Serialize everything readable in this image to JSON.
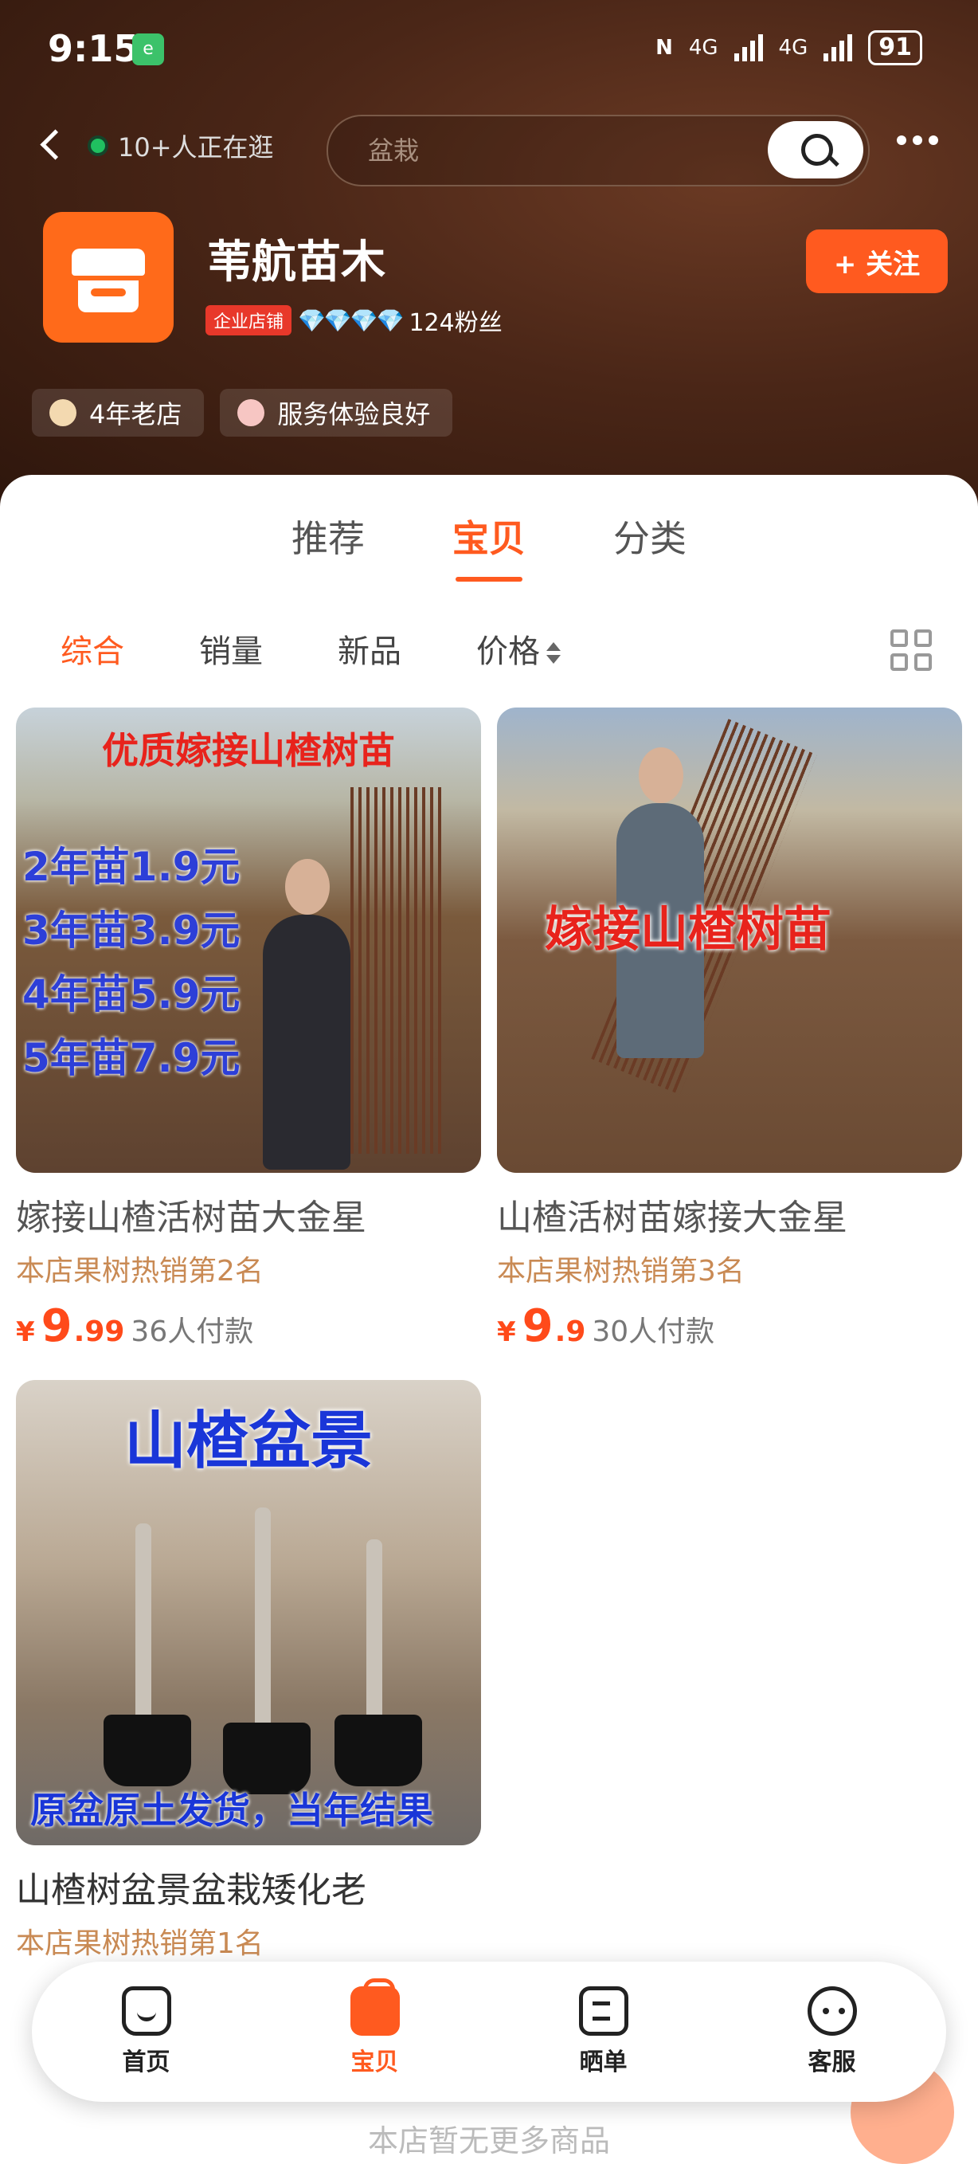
{
  "status_bar": {
    "time": "9:15",
    "app_badge": "e",
    "net1": "4G",
    "net2": "4G",
    "battery": "91"
  },
  "nav": {
    "viewers": "10+人正在逛",
    "search_placeholder": "盆栽"
  },
  "shop": {
    "name": "苇航苗木",
    "badge": "企业店铺",
    "diamonds": "💎💎💎💎",
    "fans": "124粉丝",
    "follow_label": "+ 关注",
    "tags": [
      "4年老店",
      "服务体验良好"
    ]
  },
  "tabs": [
    "推荐",
    "宝贝",
    "分类"
  ],
  "active_tab": "宝贝",
  "sorts": [
    "综合",
    "销量",
    "新品",
    "价格"
  ],
  "products": [
    {
      "title": "嫁接山楂活树苗大金星",
      "rank": "本店果树热销第2名",
      "price_int": "9",
      "price_dec": ".99",
      "sold": "36人付款",
      "image_text": "优质嫁接山楂树苗",
      "image_lines": [
        "2年苗1.9元",
        "3年苗3.9元",
        "4年苗5.9元",
        "5年苗7.9元"
      ]
    },
    {
      "title": "山楂活树苗嫁接大金星",
      "rank": "本店果树热销第3名",
      "price_int": "9",
      "price_dec": ".9",
      "sold": "30人付款",
      "image_text": "嫁接山楂树苗"
    },
    {
      "title": "山楂树盆景盆栽矮化老",
      "rank": "本店果树热销第1名",
      "image_text": "山楂盆景",
      "image_bottom_text": "原盆原土发货，当年结果"
    }
  ],
  "bottom_nav": [
    "首页",
    "宝贝",
    "晒单",
    "客服"
  ],
  "footer_text": "本店暂无更多商品",
  "colors": {
    "accent": "#ff5a1f",
    "header_bg": "#3a1d10"
  }
}
